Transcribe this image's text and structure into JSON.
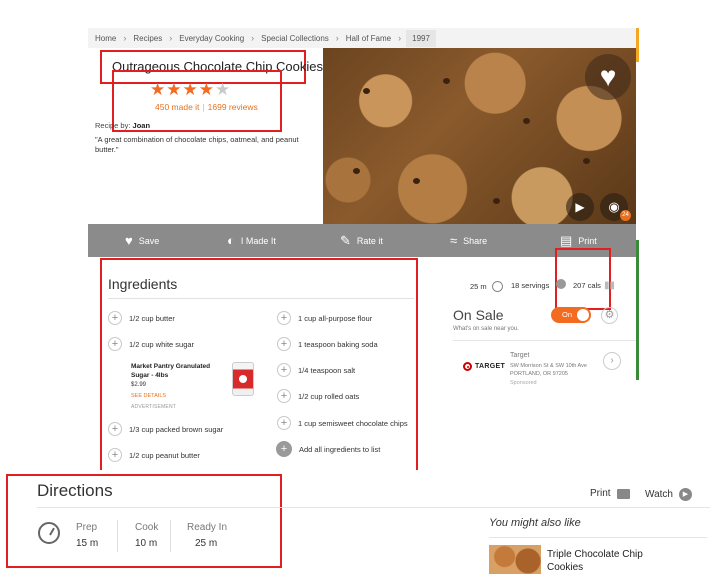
{
  "breadcrumb": [
    "Home",
    "Recipes",
    "Everyday Cooking",
    "Special Collections",
    "Hall of Fame",
    "1997"
  ],
  "recipe": {
    "title": "Outrageous Chocolate Chip Cookies",
    "rating_value": 4.5,
    "made_it_count": "450 made it",
    "reviews_count": "1699 reviews",
    "byline_label": "Recipe by:",
    "author": "Joan",
    "blurb": "\"A great combination of chocolate chips, oatmeal, and peanut butter.\""
  },
  "photo": {
    "photo_count": "24",
    "icons": [
      "heart-icon",
      "play-icon",
      "camera-icon"
    ]
  },
  "actions": [
    {
      "label": "Save",
      "icon": "heart-icon"
    },
    {
      "label": "I Made It",
      "icon": "made-it-icon"
    },
    {
      "label": "Rate it",
      "icon": "rate-icon"
    },
    {
      "label": "Share",
      "icon": "share-icon"
    },
    {
      "label": "Print",
      "icon": "print-icon"
    }
  ],
  "ingredients": {
    "title": "Ingredients",
    "col1": [
      "1/2 cup butter",
      "1/2 cup white sugar",
      "1/3 cup packed brown sugar",
      "1/2 cup peanut butter"
    ],
    "col2": [
      "1 cup all-purpose flour",
      "1 teaspoon baking soda",
      "1/4 teaspoon salt",
      "1/2 cup rolled oats",
      "1 cup semisweet chocolate chips"
    ],
    "add_all": "Add all ingredients to list"
  },
  "ad": {
    "name": "Market Pantry Granulated Sugar - 4lbs",
    "price": "$2.99",
    "link": "SEE DETAILS",
    "tag": "ADVERTISEMENT"
  },
  "meta": {
    "time": "25 m",
    "servings": "18 servings",
    "calories": "207 cals"
  },
  "on_sale": {
    "title": "On Sale",
    "subtitle": "What's on sale near you.",
    "toggle_label": "On",
    "toggle_on": true,
    "store_brand": "TARGET",
    "store_name": "Target",
    "store_address": "SW Morrison St & SW 10th Ave PORTLAND, OR 97205",
    "sponsored": "Sponsored"
  },
  "directions": {
    "title": "Directions",
    "print_label": "Print",
    "watch_label": "Watch",
    "prep_label": "Prep",
    "prep_value": "15 m",
    "cook_label": "Cook",
    "cook_value": "10 m",
    "ready_label": "Ready In",
    "ready_value": "25 m"
  },
  "also_like": {
    "title": "You might also like",
    "item": "Triple Chocolate Chip Cookies"
  },
  "colors": {
    "accent": "#f26b21",
    "highlight_box": "#e02020",
    "action_bar": "#8b8b8b"
  }
}
